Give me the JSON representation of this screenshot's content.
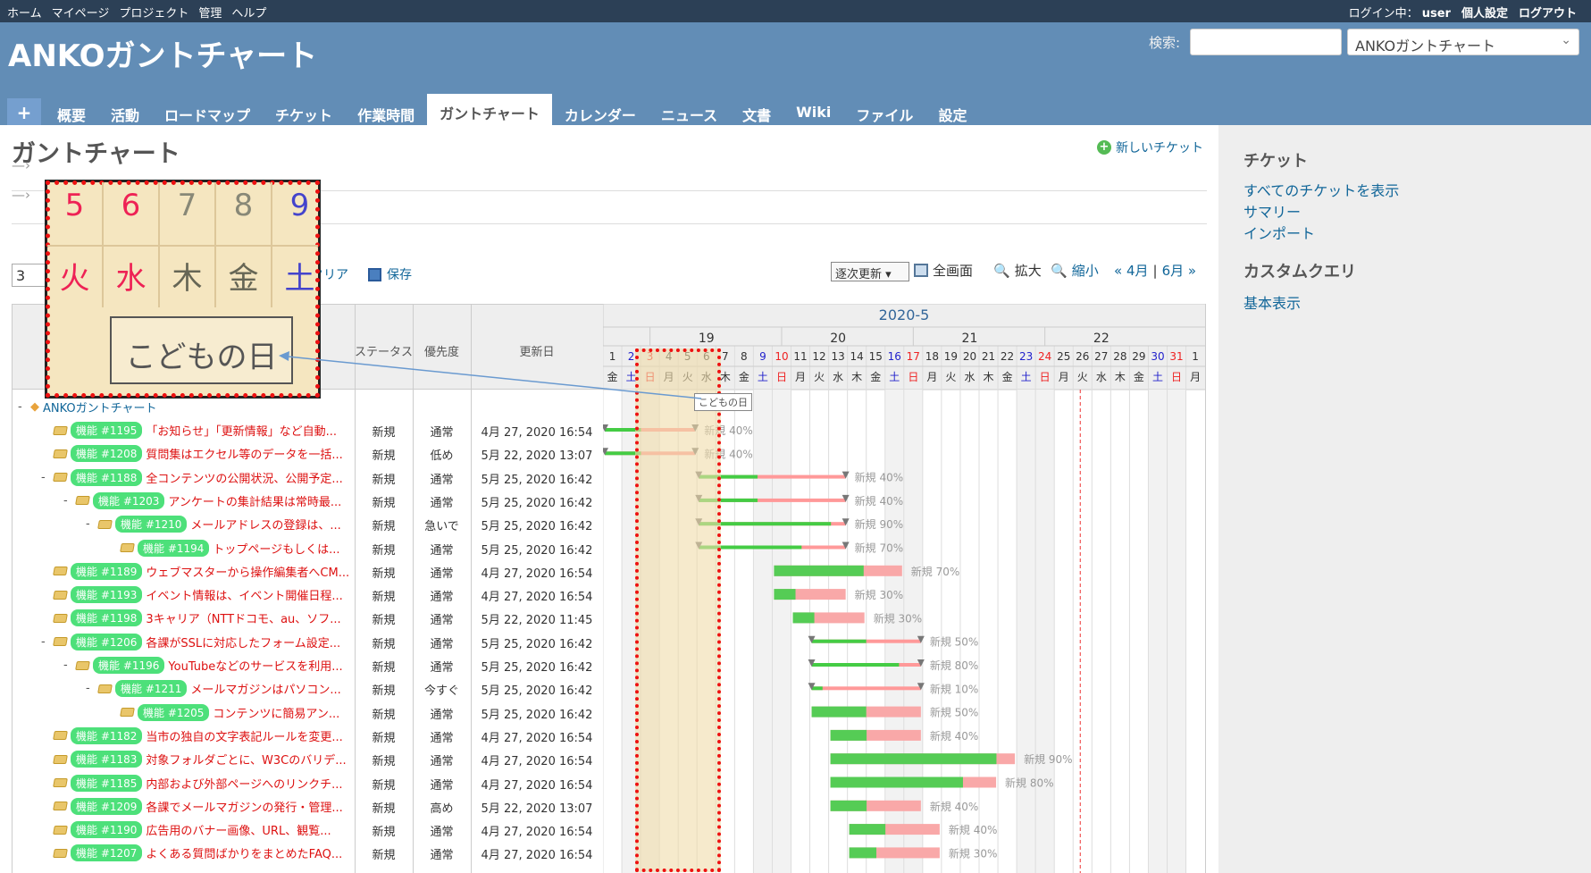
{
  "top_menu": {
    "home": "ホーム",
    "mypage": "マイページ",
    "projects": "プロジェクト",
    "admin": "管理",
    "help": "ヘルプ",
    "logged_label": "ログイン中：",
    "user": "user",
    "settings": "個人設定",
    "logout": "ログアウト"
  },
  "header": {
    "title": "ANKOガントチャート",
    "search_label": "検索:",
    "project_select": "ANKOガントチャート"
  },
  "tabs": [
    "+",
    "概要",
    "活動",
    "ロードマップ",
    "チケット",
    "作業時間",
    "ガントチャート",
    "カレンダー",
    "ニュース",
    "文書",
    "Wiki",
    "ファイル",
    "設定"
  ],
  "selected_tab": "ガントチャート",
  "page": {
    "title": "ガントチャート",
    "new_issue": "新しいチケット",
    "months": "3",
    "clear": "クリア",
    "save": "保存",
    "update_mode": "逐次更新",
    "fullscreen": "全画面",
    "zoom_in": "拡大",
    "zoom_out": "縮小",
    "prev": "« 4月",
    "sep": "|",
    "next": "6月 »"
  },
  "sidebar": {
    "issues_heading": "チケット",
    "links": [
      "すべてのチケットを表示",
      "サマリー",
      "インポート"
    ],
    "queries_heading": "カスタムクエリ",
    "query_links": [
      "基本表示"
    ]
  },
  "columns": {
    "status": "ステータス",
    "priority": "優先度",
    "updated": "更新日"
  },
  "gantt": {
    "month": "2020-5",
    "weeks": [
      "19",
      "20",
      "21",
      "22"
    ],
    "days": [
      "1",
      "2",
      "3",
      "4",
      "5",
      "6",
      "7",
      "8",
      "9",
      "10",
      "11",
      "12",
      "13",
      "14",
      "15",
      "16",
      "17",
      "18",
      "19",
      "20",
      "21",
      "22",
      "23",
      "24",
      "25",
      "26",
      "27",
      "28",
      "29",
      "30",
      "31",
      "1"
    ],
    "weekdays": [
      "金",
      "土",
      "日",
      "月",
      "火",
      "水",
      "木",
      "金",
      "土",
      "日",
      "月",
      "火",
      "水",
      "木",
      "金",
      "土",
      "日",
      "月",
      "火",
      "水",
      "木",
      "金",
      "土",
      "日",
      "月",
      "火",
      "水",
      "木",
      "金",
      "土",
      "日",
      "月"
    ],
    "holiday_tooltip": "こどもの日"
  },
  "project_row": {
    "name": "ANKOガントチャート"
  },
  "issues": [
    {
      "id": "機能 #1195",
      "subject": "「お知らせ」「更新情報」など自動...",
      "status": "新規",
      "priority": "通常",
      "updated": "4月 27, 2020 16:54",
      "bar": "新規 40%"
    },
    {
      "id": "機能 #1208",
      "subject": "質問集はエクセル等のデータを一括...",
      "status": "新規",
      "priority": "低め",
      "updated": "5月 22, 2020 13:07",
      "bar": "新規 40%"
    },
    {
      "id": "機能 #1188",
      "subject": "全コンテンツの公開状況、公開予定...",
      "status": "新規",
      "priority": "通常",
      "updated": "5月 25, 2020 16:42",
      "bar": "新規 40%"
    },
    {
      "id": "機能 #1203",
      "subject": "アンケートの集計結果は常時最...",
      "status": "新規",
      "priority": "通常",
      "updated": "5月 25, 2020 16:42",
      "bar": "新規 40%"
    },
    {
      "id": "機能 #1210",
      "subject": "メールアドレスの登録は、...",
      "status": "新規",
      "priority": "急いで",
      "updated": "5月 25, 2020 16:42",
      "bar": "新規 90%"
    },
    {
      "id": "機能 #1194",
      "subject": "トップページもしくは...",
      "status": "新規",
      "priority": "通常",
      "updated": "5月 25, 2020 16:42",
      "bar": "新規 70%"
    },
    {
      "id": "機能 #1189",
      "subject": "ウェブマスターから操作編集者へCM...",
      "status": "新規",
      "priority": "通常",
      "updated": "4月 27, 2020 16:54",
      "bar": "新規 70%"
    },
    {
      "id": "機能 #1193",
      "subject": "イベント情報は、イベント開催日程...",
      "status": "新規",
      "priority": "通常",
      "updated": "4月 27, 2020 16:54",
      "bar": "新規 30%"
    },
    {
      "id": "機能 #1198",
      "subject": "3キャリア（NTTドコモ、au、ソフ...",
      "status": "新規",
      "priority": "通常",
      "updated": "5月 22, 2020 11:45",
      "bar": "新規 30%"
    },
    {
      "id": "機能 #1206",
      "subject": "各課がSSLに対応したフォーム設定...",
      "status": "新規",
      "priority": "通常",
      "updated": "5月 25, 2020 16:42",
      "bar": "新規 50%"
    },
    {
      "id": "機能 #1196",
      "subject": "YouTubeなどのサービスを利用...",
      "status": "新規",
      "priority": "通常",
      "updated": "5月 25, 2020 16:42",
      "bar": "新規 80%"
    },
    {
      "id": "機能 #1211",
      "subject": "メールマガジンはパソコン...",
      "status": "新規",
      "priority": "今すぐ",
      "updated": "5月 25, 2020 16:42",
      "bar": "新規 10%"
    },
    {
      "id": "機能 #1205",
      "subject": "コンテンツに簡易アン...",
      "status": "新規",
      "priority": "通常",
      "updated": "5月 25, 2020 16:42",
      "bar": "新規 50%"
    },
    {
      "id": "機能 #1182",
      "subject": "当市の独自の文字表記ルールを変更...",
      "status": "新規",
      "priority": "通常",
      "updated": "4月 27, 2020 16:54",
      "bar": "新規 40%"
    },
    {
      "id": "機能 #1183",
      "subject": "対象フォルダごとに、W3Cのバリデ...",
      "status": "新規",
      "priority": "通常",
      "updated": "4月 27, 2020 16:54",
      "bar": "新規 90%"
    },
    {
      "id": "機能 #1185",
      "subject": "内部および外部ページへのリンクチ...",
      "status": "新規",
      "priority": "通常",
      "updated": "4月 27, 2020 16:54",
      "bar": "新規 80%"
    },
    {
      "id": "機能 #1209",
      "subject": "各課でメールマガジンの発行・管理...",
      "status": "新規",
      "priority": "高め",
      "updated": "5月 22, 2020 13:07",
      "bar": "新規 40%"
    },
    {
      "id": "機能 #1190",
      "subject": "広告用のバナー画像、URL、観覧...",
      "status": "新規",
      "priority": "通常",
      "updated": "4月 27, 2020 16:54",
      "bar": "新規 40%"
    },
    {
      "id": "機能 #1207",
      "subject": "よくある質問ばかりをまとめたFAQ...",
      "status": "新規",
      "priority": "通常",
      "updated": "4月 27, 2020 16:54",
      "bar": "新規 30%"
    }
  ],
  "zoom": {
    "days": [
      "5",
      "6",
      "7",
      "8",
      "9"
    ],
    "weekdays": [
      "火",
      "水",
      "木",
      "金",
      "土"
    ],
    "tooltip": "こどもの日"
  }
}
